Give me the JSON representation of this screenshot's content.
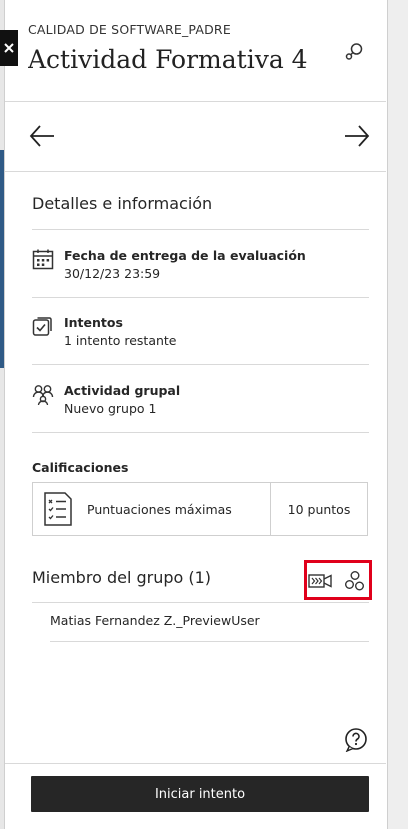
{
  "header": {
    "course": "CALIDAD DE SOFTWARE_PADRE",
    "title": "Actividad Formativa 4"
  },
  "details": {
    "section_title": "Detalles e información",
    "items": [
      {
        "icon": "calendar-icon",
        "label": "Fecha de entrega de la evaluación",
        "value": "30/12/23 23:59"
      },
      {
        "icon": "attempts-icon",
        "label": "Intentos",
        "value": "1 intento restante"
      },
      {
        "icon": "group-icon",
        "label": "Actividad grupal",
        "value": "Nuevo grupo 1"
      }
    ]
  },
  "grades": {
    "title": "Calificaciones",
    "row_label": "Puntuaciones máximas",
    "row_value": "10 puntos"
  },
  "members": {
    "title": "Miembro del grupo (1)",
    "list": [
      "Matias Fernandez Z._PreviewUser"
    ],
    "highlight_color": "#e0001b"
  },
  "footer": {
    "start_label": "Iniciar intento"
  }
}
